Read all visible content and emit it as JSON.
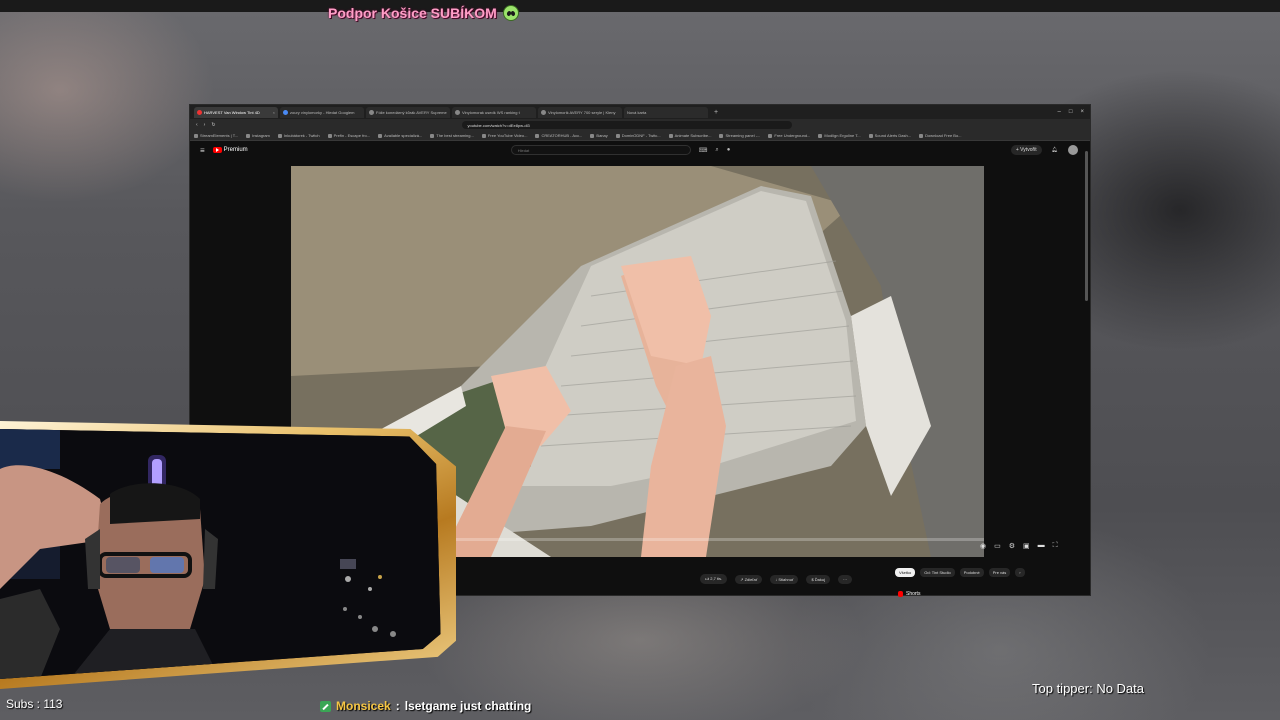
{
  "alert": {
    "text": "Podpor Košice SUBÍKOM",
    "icon": "alien-emoji-icon"
  },
  "browser": {
    "tabs": [
      {
        "label": "HARVEST Van Window Tint 4D"
      },
      {
        "label": "zoury vinylomorky - Hledat Googlem"
      },
      {
        "label": "Fólie konedárný kůrák AVERY Supreme"
      },
      {
        "label": "Vinylomorak usedk WS ranking t"
      },
      {
        "label": "Vinylomorik AVERY 700 seryle | Kleny"
      },
      {
        "label": "Nová karta"
      }
    ],
    "new_tab": "+",
    "window_controls": [
      "–",
      "□",
      "×"
    ],
    "url": "youtube.com/watch?v=dEe8pw-dl3",
    "bookmarks": [
      "StreamElements | T...",
      "Instagram",
      "Inkubátorek - Twitch",
      "Prefin - Escape fro...",
      "Available specializá...",
      "The best streaming...",
      "Free YouTube Video...",
      "CREATORHUB - Acc...",
      "Banay",
      "DominODNF - Twitc...",
      "Animate Subscribe...",
      "Streaming panel -...",
      "Free Underground...",
      "Modlign Ergoline T...",
      "Sound Alerts Dash...",
      "Download Free Bo..."
    ]
  },
  "youtube": {
    "logo": "Premium",
    "search_placeholder": "Hledat",
    "create_label": "Vytvořit",
    "actions": [
      "2,7 tis.",
      "Zdieľať",
      "Stiahnuť",
      "Ďakuj",
      "···"
    ],
    "chips": [
      {
        "label": "Všetko",
        "active": true
      },
      {
        "label": "Od: Tint Studio",
        "active": false
      },
      {
        "label": "Podobné",
        "active": false
      },
      {
        "label": "Pre vás",
        "active": false
      }
    ],
    "shorts_label": "Shorts",
    "progress_fraction": 0.18
  },
  "overlay": {
    "subs": "Subs : 113",
    "chat_user": "Monsicek",
    "chat_sep": ":",
    "chat_msg": "lsetgame just chatting",
    "top_tipper": "Top tipper: No Data"
  },
  "colors": {
    "alert_pink": "#ff9ec7",
    "chat_user": "#f6c644",
    "yt_red": "#ff0000",
    "frame_gold": "#e9c06a"
  }
}
